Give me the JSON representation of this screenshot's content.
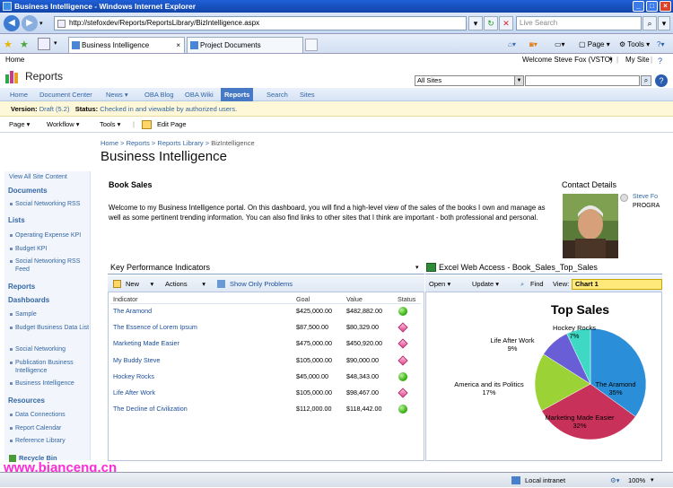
{
  "window": {
    "title": "Business Intelligence - Windows Internet Explorer"
  },
  "browser": {
    "address": "http://stefoxdev/Reports/ReportsLibrary/BizIntelligence.aspx",
    "search_placeholder": "Live Search",
    "tabs": [
      {
        "label": "Business Intelligence"
      },
      {
        "label": "Project Documents"
      }
    ],
    "toolbar": {
      "page": "Page",
      "tools": "Tools"
    }
  },
  "site": {
    "home_link": "Home",
    "welcome": "Welcome Steve Fox (VSTO)",
    "mysite": "My Site",
    "title": "Reports",
    "scope": "All Sites",
    "nav": [
      "Home",
      "Document Center",
      "News",
      "OBA Blog",
      "OBA Wiki",
      "Reports",
      "Search",
      "Sites"
    ],
    "version_label": "Version:",
    "version_value": "Draft (5.2)",
    "status_label": "Status:",
    "status_value": "Checked in and viewable by authorized users.",
    "tools": {
      "page": "Page",
      "workflow": "Workflow",
      "tools": "Tools",
      "edit": "Edit Page"
    }
  },
  "breadcrumb": {
    "home": "Home",
    "reports": "Reports",
    "library": "Reports Library",
    "current": "BizIntelligence"
  },
  "page_title": "Business Intelligence",
  "leftnav": {
    "view_all": "View All Site Content",
    "sections": [
      {
        "h": "Documents",
        "items": [
          "Social Networking RSS"
        ]
      },
      {
        "h": "Lists",
        "items": [
          "Operating Expense KPI",
          "Budget KPI",
          "Social Networking RSS Feed"
        ]
      },
      {
        "h": "Reports",
        "items": []
      },
      {
        "h": "Dashboards",
        "items": [
          "Sample",
          "Budget Business Data List",
          "Social Networking",
          "Publication Business Intelligence",
          "Business Intelligence"
        ]
      },
      {
        "h": "Resources",
        "items": [
          "Data Connections",
          "Report Calendar",
          "Reference Library"
        ]
      }
    ],
    "recycle": "Recycle Bin"
  },
  "book_sales": {
    "heading": "Book Sales",
    "text": "Welcome to my Business Intelligence portal. On this dashboard, you will find a high-level view of the sales of the books I own and manage as well as some pertinent trending information. You can also find links to other sites that I think are important - both professional and personal."
  },
  "contact": {
    "heading": "Contact Details",
    "name": "Steve Fo",
    "role": "PROGRA"
  },
  "kpi": {
    "heading": "Key Performance Indicators",
    "tools": {
      "new": "New",
      "actions": "Actions",
      "problems": "Show Only Problems"
    },
    "columns": [
      "Indicator",
      "Goal",
      "Value",
      "Status"
    ],
    "rows": [
      {
        "name": "The Aramond",
        "goal": "$425,000.00",
        "value": "$482,882.00",
        "status": "green"
      },
      {
        "name": "The Essence of Lorem Ipsum",
        "goal": "$87,500.00",
        "value": "$80,329.00",
        "status": "pink"
      },
      {
        "name": "Marketing Made Easier",
        "goal": "$475,000.00",
        "value": "$450,920.00",
        "status": "pink"
      },
      {
        "name": "My Buddy Steve",
        "goal": "$105,000.00",
        "value": "$90,000.00",
        "status": "pink"
      },
      {
        "name": "Hockey Rocks",
        "goal": "$45,000.00",
        "value": "$48,343.00",
        "status": "green"
      },
      {
        "name": "Life After Work",
        "goal": "$105,000.00",
        "value": "$98,467.00",
        "status": "pink"
      },
      {
        "name": "The Decline of Civilization",
        "goal": "$112,000.00",
        "value": "$118,442.00",
        "status": "green"
      }
    ]
  },
  "ewa": {
    "heading": "Excel Web Access - Book_Sales_Top_Sales",
    "tools": {
      "open": "Open",
      "update": "Update",
      "find": "Find",
      "view_label": "View:",
      "view_value": "Chart 1"
    }
  },
  "chart_data": {
    "type": "pie",
    "title": "Top Sales",
    "slices": [
      {
        "label": "The Aramond",
        "pct": "35%",
        "value": 35,
        "color": "#2a8fd8"
      },
      {
        "label": "Marketing Made Easier",
        "pct": "32%",
        "value": 32,
        "color": "#c8325a"
      },
      {
        "label": "America and its Politics",
        "pct": "17%",
        "value": 17,
        "color": "#9bd235"
      },
      {
        "label": "Life After Work",
        "pct": "9%",
        "value": 9,
        "color": "#6a5ed6"
      },
      {
        "label": "Hockey Rocks",
        "pct": "7%",
        "value": 7,
        "color": "#3ed8c4"
      }
    ]
  },
  "ie_status": {
    "zone": "Local intranet",
    "zoom": "100%"
  },
  "watermark": "www.bianceng.cn"
}
